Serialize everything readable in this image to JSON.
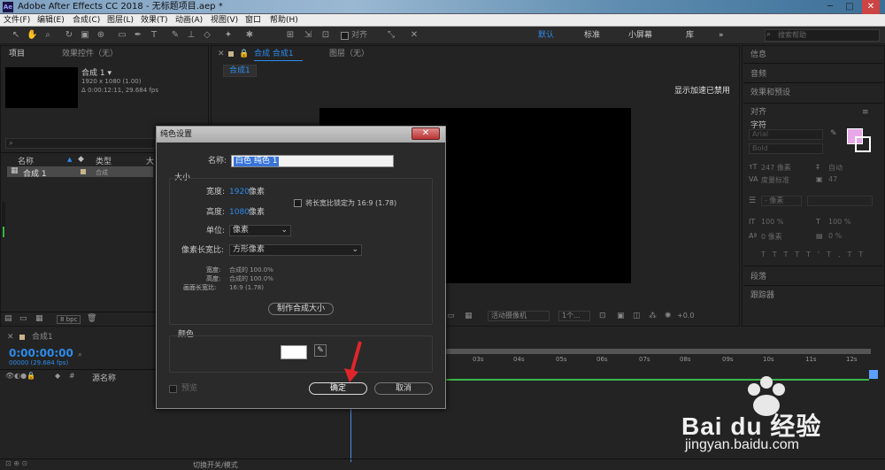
{
  "app": {
    "title": "Adobe After Effects CC 2018 - 无标题项目.aep *",
    "icon": "Ae"
  },
  "window_controls": [
    "─",
    "□",
    "✕"
  ],
  "menu": [
    "文件(F)",
    "编辑(E)",
    "合成(C)",
    "图层(L)",
    "效果(T)",
    "动画(A)",
    "视图(V)",
    "窗口",
    "帮助(H)"
  ],
  "toolbar": {
    "snap_label": "对齐",
    "workspaces": [
      "默认",
      "标准",
      "小屏幕",
      "库"
    ],
    "more": "»",
    "search_placeholder": "搜索帮助"
  },
  "project_panel": {
    "tab": "项目",
    "tab2": "效果控件（无）",
    "comp_name": "合成 1 ▾",
    "comp_info1": "1920 x 1080 (1.00)",
    "comp_info2": "Δ 0:00:12:11, 29.684 fps",
    "col_name": "名称",
    "col_type": "类型",
    "col_more": "大",
    "item_name": "合成 1",
    "item_type": "合成",
    "bpc": "8 bpc"
  },
  "comp_panel": {
    "tab": "合成 合成1",
    "layer_tab": "图层（无）",
    "subtab": "合成1",
    "gpu_msg": "显示加速已禁用",
    "camera": "活动摄像机",
    "views": "1个...",
    "exposure": "+0.0"
  },
  "right_panel": {
    "items": [
      "信息",
      "音频",
      "效果和预设",
      "对齐",
      "字符",
      "段落",
      "跟踪器"
    ],
    "font": "Arial",
    "style": "Bold",
    "size": "247 像素",
    "leading": "自动",
    "kerning": "度量标准",
    "tracking": "47",
    "unit": "- 像素",
    "vscale": "100 %",
    "hscale": "100 %",
    "baseline": "0 像素",
    "tsume": "0 %",
    "fill_color": "#e6a8e6"
  },
  "timeline": {
    "tab": "合成1",
    "timecode": "0:00:00:00",
    "fps": "00000 (29.684 fps)",
    "col_source": "源名称",
    "switch_label": "切换开关/模式",
    "ticks": [
      "03s",
      "04s",
      "05s",
      "06s",
      "07s",
      "08s",
      "09s",
      "10s",
      "11s",
      "12s"
    ]
  },
  "dialog": {
    "title": "纯色设置",
    "name_label": "名称:",
    "name_value": "白色 纯色 1",
    "size_group": "大小",
    "width_label": "宽度:",
    "width_value": "1920",
    "height_label": "高度:",
    "height_value": "1080",
    "unit_suffix": "像素",
    "lock_label": "将长宽比锁定为 16:9 (1.78)",
    "unit_label": "单位:",
    "unit_value": "像素",
    "pixel_aspect_label": "像素长宽比:",
    "pixel_aspect_value": "方形像素",
    "ratio_w_label": "宽度:",
    "ratio_w_value": "合成的 100.0%",
    "ratio_h_label": "高度:",
    "ratio_h_value": "合成的 100.0%",
    "frame_aspect_label": "画面长宽比:",
    "frame_aspect_value": "16:9 (1.78)",
    "make_comp_size": "制作合成大小",
    "color_group": "颜色",
    "preview_label": "预览",
    "ok": "确定",
    "cancel": "取消"
  },
  "watermark": {
    "brand": "Bai du 经验",
    "url": "jingyan.baidu.com"
  }
}
